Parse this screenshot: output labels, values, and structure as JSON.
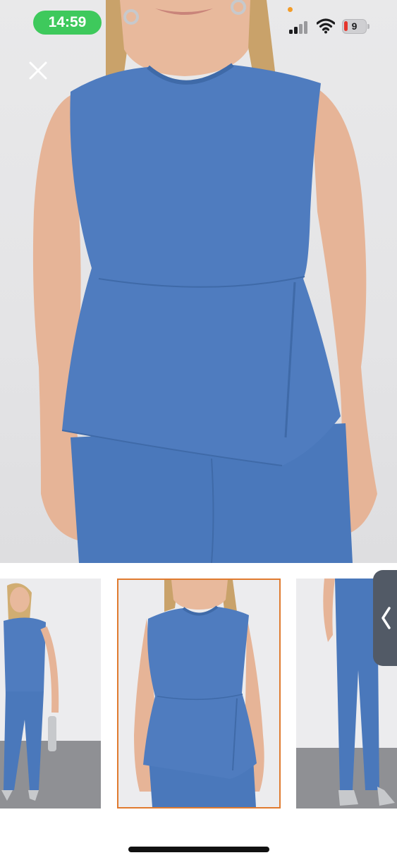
{
  "status_bar": {
    "time": "14:59",
    "battery_level": "9",
    "time_pill_color": "#3ec95c",
    "battery_color": "#e5352b",
    "recording_dot_color": "#f39c28"
  },
  "icons": {
    "close": "close-icon",
    "signal": "cellular-signal-icon",
    "wifi": "wifi-icon",
    "battery": "battery-charging-icon",
    "collapse": "chevron-left-icon"
  },
  "gallery": {
    "selected_index": 1,
    "accent_color": "#e07b2f",
    "garment_color": "#4f7cbf",
    "thumbnails": [
      {
        "view": "full-body-front"
      },
      {
        "view": "close-up-front"
      },
      {
        "view": "legs-detail"
      }
    ]
  }
}
